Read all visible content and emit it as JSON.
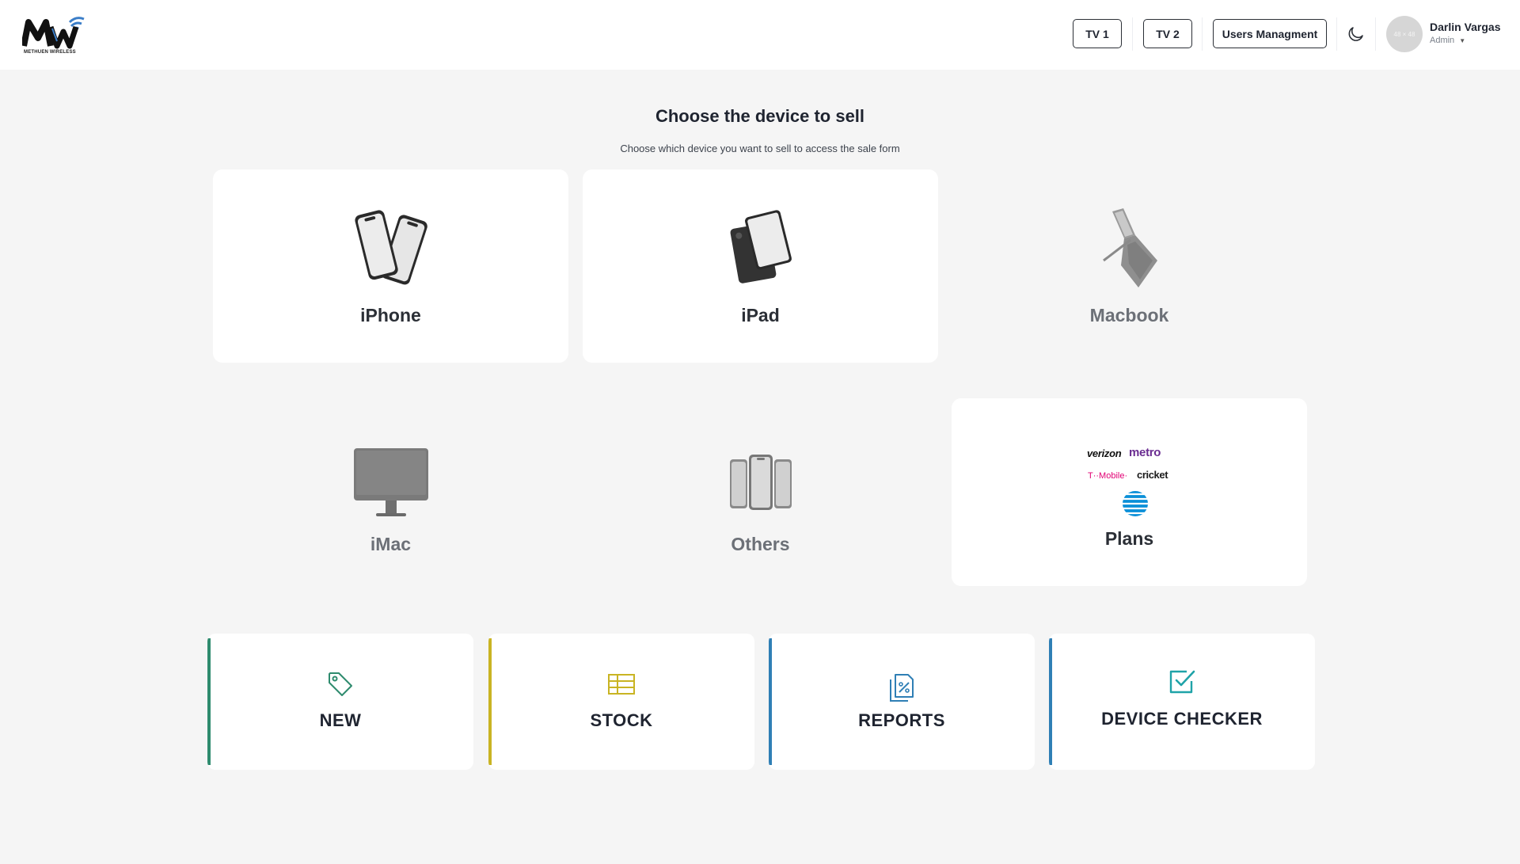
{
  "brand": {
    "logo_text": "MW",
    "tagline": "METHUEN WIRELESS"
  },
  "header": {
    "tv1_label": "TV 1",
    "tv2_label": "TV 2",
    "users_label": "Users Managment",
    "avatar_placeholder": "48 × 48",
    "user_name": "Darlin Vargas",
    "user_role": "Admin"
  },
  "main": {
    "title": "Choose the device to sell",
    "subtitle": "Choose which device you want to sell to access the sale form"
  },
  "devices": [
    {
      "label": "iPhone",
      "icon": "iphone-icon",
      "active": true
    },
    {
      "label": "iPad",
      "icon": "ipad-icon",
      "active": true
    },
    {
      "label": "Macbook",
      "icon": "macbook-icon",
      "active": false
    },
    {
      "label": "iMac",
      "icon": "imac-icon",
      "active": false
    },
    {
      "label": "Others",
      "icon": "phones-icon",
      "active": false
    },
    {
      "label": "Plans",
      "icon": "carrier-logos",
      "active": true
    }
  ],
  "carriers": [
    "verizon",
    "metro",
    "T··Mobile·",
    "cricket",
    "AT&T"
  ],
  "actions": [
    {
      "label": "NEW",
      "icon": "tag-icon",
      "color": "#2e8b6e"
    },
    {
      "label": "STOCK",
      "icon": "table-icon",
      "color": "#c9b423"
    },
    {
      "label": "REPORTS",
      "icon": "report-icon",
      "color": "#2f7fb5"
    },
    {
      "label": "DEVICE CHECKER",
      "icon": "check-square-icon",
      "color": "#1fa3a8"
    }
  ],
  "colors": {
    "background": "#f5f5f5",
    "card": "#ffffff",
    "text": "#1f2430",
    "muted": "#6c7077"
  }
}
